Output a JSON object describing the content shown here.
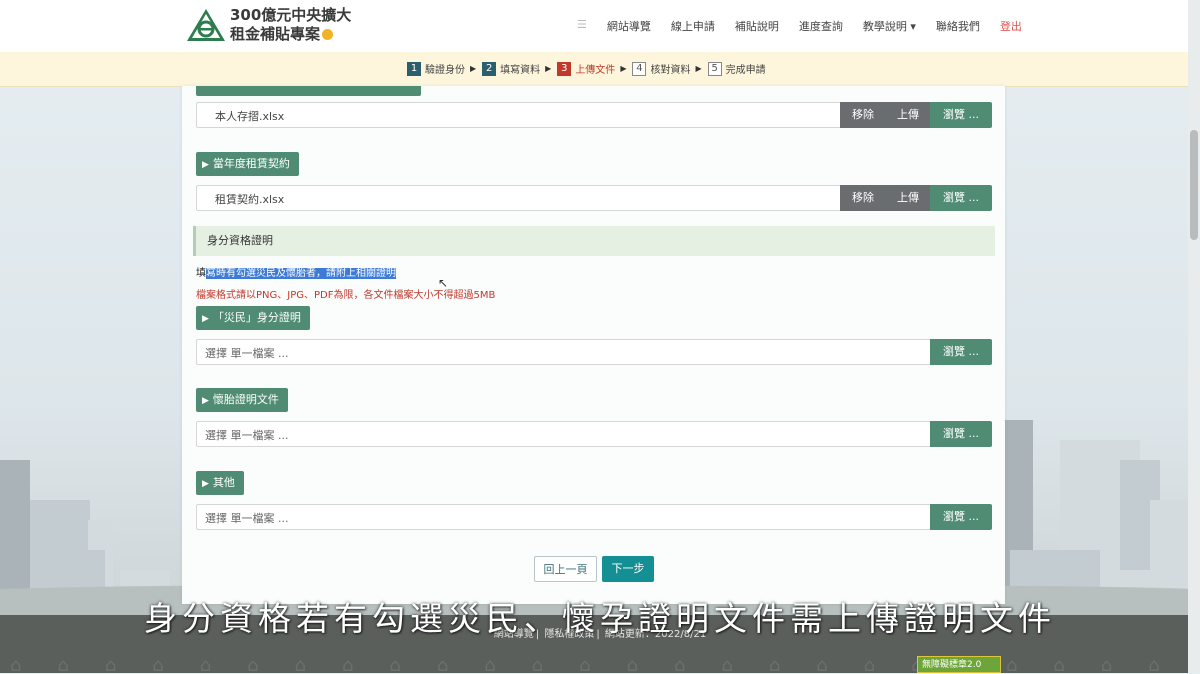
{
  "header": {
    "logo_line1": "300億元中央擴大",
    "logo_line2": "租金補貼專案",
    "nav": [
      "網站導覽",
      "線上申請",
      "補貼說明",
      "進度查詢",
      "教學說明 ▾",
      "聯絡我們"
    ],
    "logout": "登出"
  },
  "steps": [
    {
      "num": "1",
      "label": "驗證身份",
      "state": "done"
    },
    {
      "num": "2",
      "label": "填寫資料",
      "state": "done"
    },
    {
      "num": "3",
      "label": "上傳文件",
      "state": "current"
    },
    {
      "num": "4",
      "label": "核對資料",
      "state": "todo"
    },
    {
      "num": "5",
      "label": "完成申請",
      "state": "todo"
    }
  ],
  "uploads": {
    "row1": {
      "file": "本人存摺.xlsx"
    },
    "contract": {
      "title": "當年度租賃契約",
      "file": "租賃契約.xlsx"
    },
    "buttons": {
      "remove": "移除",
      "upload": "上傳",
      "browse": "瀏覽 ..."
    }
  },
  "identity": {
    "section_title": "身分資格證明",
    "note_prefix": "填",
    "note_highlight": "寫時有勾選災民及懷胎者，請附上相關證明",
    "format_note": "檔案格式請以PNG、JPG、PDF為限，各文件檔案大小不得超過5MB",
    "placeholder": "選擇 單一檔案 ...",
    "items": [
      "「災民」身分證明",
      "懷胎證明文件",
      "其他"
    ]
  },
  "actions": {
    "prev": "回上一頁",
    "next": "下一步"
  },
  "footer": {
    "link1": "網站導覽",
    "link2": "隱私權政策",
    "updated": "網站更新：2022/8/21",
    "badge": "無障礙標章2.0"
  },
  "subtitle": "身分資格若有勾選災民、懷孕證明文件需上傳證明文件",
  "colors": {
    "accent": "#4f8c73",
    "danger": "#c0392b",
    "next_button": "#149095",
    "step_done": "#2b5f6e"
  }
}
